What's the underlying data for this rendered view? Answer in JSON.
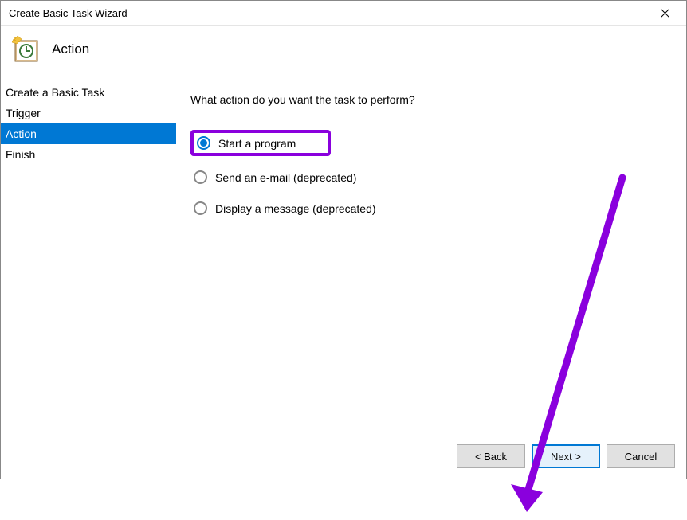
{
  "window": {
    "title": "Create Basic Task Wizard"
  },
  "header": {
    "label": "Action"
  },
  "sidebar": {
    "items": [
      {
        "label": "Create a Basic Task",
        "selected": false
      },
      {
        "label": "Trigger",
        "selected": false
      },
      {
        "label": "Action",
        "selected": true
      },
      {
        "label": "Finish",
        "selected": false
      }
    ]
  },
  "content": {
    "prompt": "What action do you want the task to perform?",
    "options": [
      {
        "label": "Start a program",
        "checked": true,
        "highlighted": true
      },
      {
        "label": "Send an e-mail (deprecated)",
        "checked": false,
        "highlighted": false
      },
      {
        "label": "Display a message (deprecated)",
        "checked": false,
        "highlighted": false
      }
    ]
  },
  "buttons": {
    "back": "< Back",
    "next": "Next >",
    "cancel": "Cancel"
  },
  "annotation": {
    "arrow_color": "#8a00dd"
  }
}
